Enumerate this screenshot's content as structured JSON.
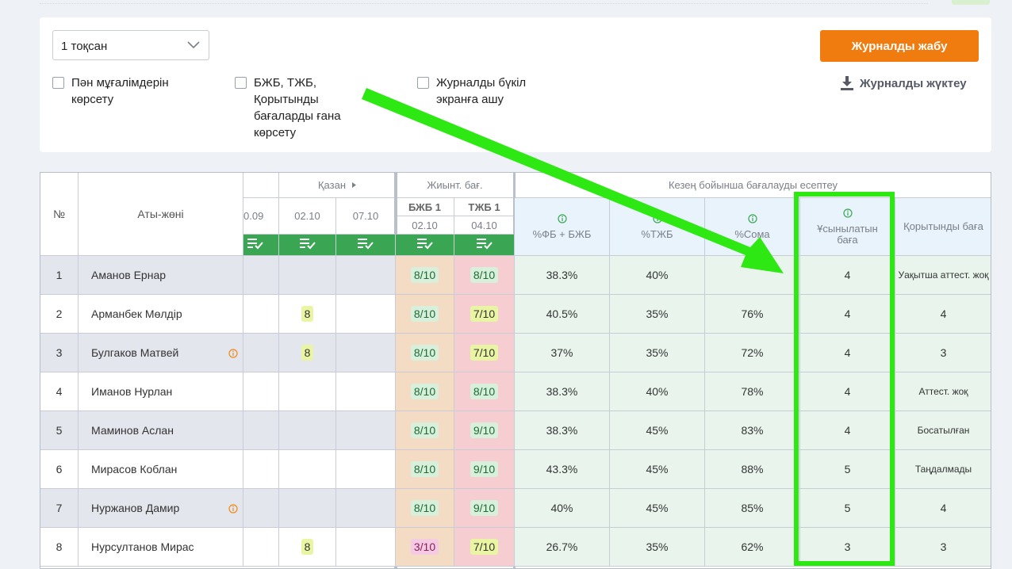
{
  "filters": {
    "quarter_select": "1 тоқсан",
    "show_teachers": "Пән мұғалімдерін көрсету",
    "show_only_marks": "БЖБ, ТЖБ, Қорытынды бағаларды ғана көрсету",
    "fullscreen": "Журналды бүкіл экранға ашу"
  },
  "actions": {
    "close_journal": "Журналды жабу",
    "download_journal": "Журналды жүктеу"
  },
  "table": {
    "col_no": "№",
    "col_name": "Аты-жөні",
    "month_label": "Қазан",
    "date_partial": "0.09",
    "dates": [
      "02.10",
      "07.10"
    ],
    "summary_group": "Жиынт. бағ.",
    "summary_cols": [
      {
        "label": "БЖБ 1",
        "date": "02.10"
      },
      {
        "label": "ТЖБ 1",
        "date": "04.10"
      }
    ],
    "period_group": "Кезең бойынша бағалауды есептеу",
    "period_cols": [
      "%ФБ + БЖБ",
      "%ТЖБ",
      "%Сома",
      "Ұсынылатын баға",
      "Қорытынды баға"
    ],
    "rows": [
      {
        "no": "1",
        "name": "Аманов Ернар",
        "d1": "",
        "d2": "",
        "info": false,
        "bjb": "8/10",
        "tjb": "8/10",
        "p1": "38.3%",
        "p2": "40%",
        "p3": "",
        "rec": "4",
        "final": "Уақытша аттест. жоқ"
      },
      {
        "no": "2",
        "name": "Арманбек Мөлдір",
        "d1": "8",
        "d2": "",
        "info": false,
        "bjb": "8/10",
        "tjb": "7/10",
        "p1": "40.5%",
        "p2": "35%",
        "p3": "76%",
        "rec": "4",
        "final": "4"
      },
      {
        "no": "3",
        "name": "Булгаков Матвей",
        "d1": "8",
        "d2": "",
        "info": true,
        "bjb": "8/10",
        "tjb": "7/10",
        "p1": "37%",
        "p2": "35%",
        "p3": "72%",
        "rec": "4",
        "final": "3"
      },
      {
        "no": "4",
        "name": "Иманов Нурлан",
        "d1": "",
        "d2": "",
        "info": false,
        "bjb": "8/10",
        "tjb": "8/10",
        "p1": "38.3%",
        "p2": "40%",
        "p3": "78%",
        "rec": "4",
        "final": "Аттест. жоқ"
      },
      {
        "no": "5",
        "name": "Маминов Аслан",
        "d1": "",
        "d2": "",
        "info": false,
        "bjb": "8/10",
        "tjb": "9/10",
        "p1": "38.3%",
        "p2": "45%",
        "p3": "83%",
        "rec": "4",
        "final": "Босатылған"
      },
      {
        "no": "6",
        "name": "Мирасов Коблан",
        "d1": "",
        "d2": "",
        "info": false,
        "bjb": "8/10",
        "tjb": "9/10",
        "p1": "43.3%",
        "p2": "45%",
        "p3": "88%",
        "rec": "5",
        "final": "Таңдалмады"
      },
      {
        "no": "7",
        "name": "Нуржанов Дамир",
        "d1": "",
        "d2": "",
        "info": true,
        "bjb": "8/10",
        "tjb": "9/10",
        "p1": "40%",
        "p2": "45%",
        "p3": "85%",
        "rec": "5",
        "final": "4"
      },
      {
        "no": "8",
        "name": "Нурсултанов Мирас",
        "d1": "8",
        "d2": "",
        "info": false,
        "bjb": "3/10",
        "tjb": "7/10",
        "p1": "26.7%",
        "p2": "35%",
        "p3": "62%",
        "rec": "3",
        "final": "3"
      }
    ]
  },
  "colors": {
    "accent_orange": "#f07b0e",
    "highlight_green": "#2ee814",
    "header_green": "#3aa654",
    "bjb_bg": "#f4dcc4",
    "tjb_bg": "#f6cdd0",
    "period_bg": "#e9f5ec"
  },
  "icons": [
    "chevron-down-icon",
    "download-icon",
    "checklist-icon",
    "info-icon",
    "caret-right-icon"
  ]
}
